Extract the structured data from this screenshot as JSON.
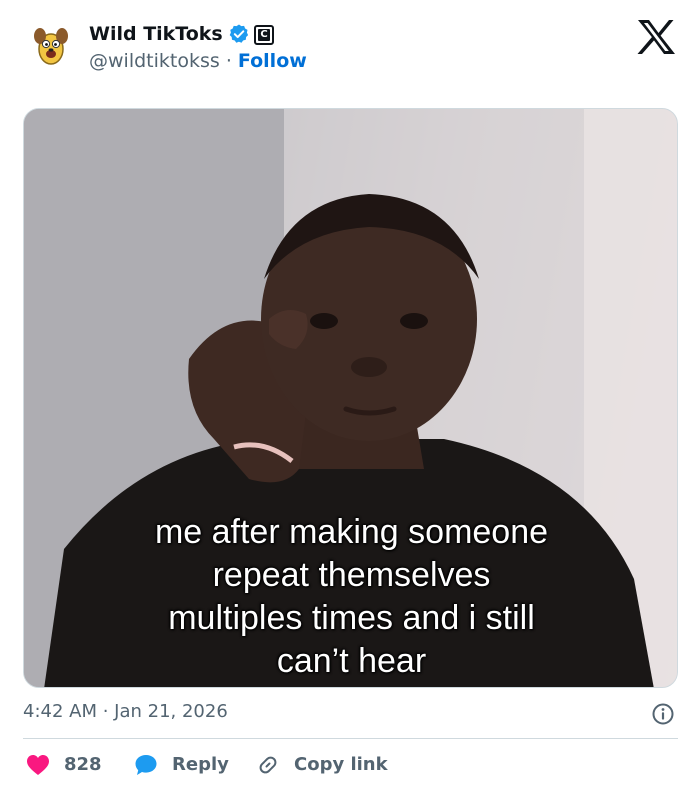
{
  "author": {
    "name": "Wild TikToks",
    "handle": "@wildtiktokss",
    "separator": "·",
    "follow_label": "Follow",
    "affiliate_badge": "C"
  },
  "icons": {
    "verified": "verified-badge-icon",
    "brand": "x-logo-icon",
    "info": "info-icon",
    "like": "heart-icon",
    "reply": "speech-bubble-icon",
    "copy": "link-icon"
  },
  "media": {
    "caption_lines": [
      "me after making someone",
      "repeat themselves",
      "multiples times and i still",
      "can’t hear"
    ]
  },
  "footer": {
    "timestamp": "4:42 AM · Jan 21, 2026"
  },
  "actions": {
    "like_count": "828",
    "reply_label": "Reply",
    "copy_label": "Copy link"
  },
  "colors": {
    "accent": "#006fd6",
    "verified": "#1d9bf0",
    "like": "#f91880",
    "text_secondary": "#536471"
  }
}
